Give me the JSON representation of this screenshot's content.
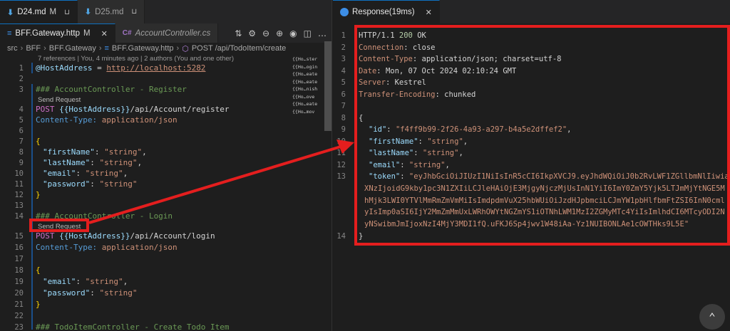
{
  "left_tabs": [
    {
      "label": "D24.md",
      "modified": "M"
    },
    {
      "label": "D25.md",
      "modified": ""
    }
  ],
  "file_tabs": [
    {
      "label": "BFF.Gateway.http",
      "modified": "M"
    },
    {
      "label": "AccountController.cs"
    }
  ],
  "breadcrumb": {
    "items": [
      "src",
      "BFF",
      "BFF.Gateway",
      "BFF.Gateway.http",
      "POST /api/TodoItem/create"
    ]
  },
  "codelens_top": "7 references | You, 4 minutes ago | 2 authors (You and one other)",
  "send_request": "Send Request",
  "code_lines": {
    "l1": {
      "num": "1",
      "var": "@HostAddress",
      "op": " = ",
      "url": "http://localhost:5282"
    },
    "l3": {
      "num": "3",
      "text": "### AccountController - Register"
    },
    "l4": {
      "num": "4",
      "method": "POST ",
      "var": "{{HostAddress}}",
      "path": "/api/Account/register"
    },
    "l5": {
      "num": "5",
      "hdr": "Content-Type:",
      "val": " application/json"
    },
    "l7": {
      "num": "7",
      "text": "{"
    },
    "l8": {
      "num": "8",
      "key": "\"firstName\"",
      "val": "\"string\"",
      "sep": ": ",
      "end": ","
    },
    "l9": {
      "num": "9",
      "key": "\"lastName\"",
      "val": "\"string\"",
      "sep": ": ",
      "end": ","
    },
    "l10": {
      "num": "10",
      "key": "\"email\"",
      "val": "\"string\"",
      "sep": ": ",
      "end": ","
    },
    "l11": {
      "num": "11",
      "key": "\"password\"",
      "val": "\"string\"",
      "sep": ": ",
      "end": ""
    },
    "l12": {
      "num": "12",
      "text": "}"
    },
    "l14": {
      "num": "14",
      "text": "### AccountController - Login"
    },
    "l15": {
      "num": "15",
      "method": "POST ",
      "var": "{{HostAddress}}",
      "path": "/api/Account/login"
    },
    "l16": {
      "num": "16",
      "hdr": "Content-Type:",
      "val": " application/json"
    },
    "l18": {
      "num": "18",
      "text": "{"
    },
    "l19": {
      "num": "19",
      "key": "\"email\"",
      "val": "\"string\"",
      "sep": ": ",
      "end": ","
    },
    "l20": {
      "num": "20",
      "key": "\"password\"",
      "val": "\"string\"",
      "sep": ": ",
      "end": ""
    },
    "l21": {
      "num": "21",
      "text": "}"
    },
    "l23": {
      "num": "23",
      "text": "### TodoItemController - Create Todo Item"
    },
    "empty": {
      "n2": "2",
      "n6": "6",
      "n13": "13",
      "n17": "17",
      "n22": "22"
    }
  },
  "minimap_items": [
    "{{Ho…ster",
    "{{Ho…ogin",
    "{{Ho…eate",
    "{{Ho…eate",
    "{{Ho…nish",
    "{{Ho…ove",
    "{{Ho…eate",
    "{{Ho…mov"
  ],
  "response_tab": {
    "label": "Response(19ms)"
  },
  "response": {
    "r1": {
      "num": "1",
      "proto": "HTTP/1.1 ",
      "code": "200",
      "text": " OK"
    },
    "r2": {
      "num": "2",
      "name": "Connection",
      "val": "close"
    },
    "r3": {
      "num": "3",
      "name": "Content-Type",
      "val": "application/json; charset=utf-8"
    },
    "r4": {
      "num": "4",
      "name": "Date",
      "val": "Mon, 07 Oct 2024 02:10:24 GMT"
    },
    "r5": {
      "num": "5",
      "name": "Server",
      "val": "Kestrel"
    },
    "r6": {
      "num": "6",
      "name": "Transfer-Encoding",
      "val": "chunked"
    },
    "r7": {
      "num": "7"
    },
    "r8": {
      "num": "8",
      "text": "{"
    },
    "r9": {
      "num": "9",
      "key": "\"id\"",
      "val": "\"f4ff9b99-2f26-4a93-a297-b4a5e2dffef2\""
    },
    "r10": {
      "num": "10",
      "key": "\"firstName\"",
      "val": "\"string\""
    },
    "r11": {
      "num": "11",
      "key": "\"lastName\"",
      "val": "\"string\""
    },
    "r12": {
      "num": "12",
      "key": "\"email\"",
      "val": "\"string\""
    },
    "r13": {
      "num": "13",
      "key": "\"token\"",
      "val": "\"eyJhbGciOiJIUzI1NiIsInR5cCI6IkpXVCJ9.eyJhdWQiOiJ0b2RvLWF1ZGllbmNlIiwia"
    },
    "token_cont": [
      "XNzIjoidG9kby1pc3N1ZXIiLCJleHAiOjE3MjgyNjczMjUsInN1YiI6ImY0ZmY5Yjk5LTJmMjYtNGE5My1",
      "hMjk3LWI0YTVlMmRmZmVmMiIsImdpdmVuX25hbWUiOiJzdHJpbmciLCJmYW1pbHlfbmFtZSI6InN0cmluZ",
      "yIsImp0aSI6IjY2MmZmMmUxLWRhOWYtNGZmYS1iOTNhLWM1MzI2ZGMyMTc4YiIsImlhdCI6MTcyODI2NzA",
      "yNSwibmJmIjoxNzI4MjY3MDI1fQ.uFKJ6Sp4jwv1W48iAa-Yz1NUIBONLAe1cOWTHks9L5E\""
    ],
    "r14": {
      "num": "14",
      "text": "}"
    }
  },
  "colors": {
    "highlight": "#e41e1e",
    "accent": "#0e70c0"
  }
}
